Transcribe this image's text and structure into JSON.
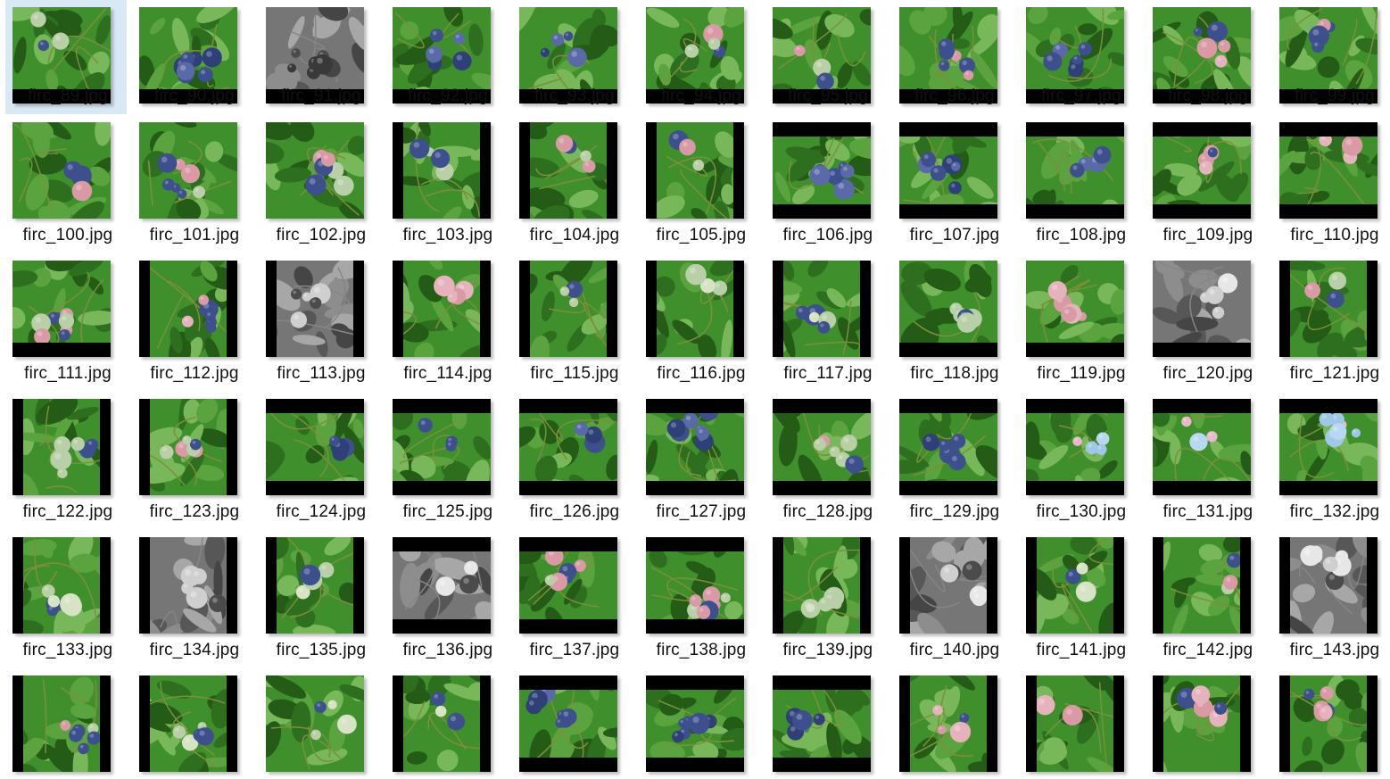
{
  "files": [
    {
      "name": "firc_89.jpg",
      "selected": true,
      "bars": "bottom",
      "gray": false,
      "tilt": 0,
      "berries": "mixed"
    },
    {
      "name": "firc_90.jpg",
      "bars": "bottom",
      "gray": false,
      "tilt": 0,
      "berries": "blue"
    },
    {
      "name": "firc_91.jpg",
      "bars": "bottom",
      "gray": true,
      "tilt": 3,
      "berries": "blue"
    },
    {
      "name": "firc_92.jpg",
      "bars": "bottom",
      "gray": false,
      "tilt": 0,
      "berries": "blue"
    },
    {
      "name": "firc_93.jpg",
      "bars": "bottom",
      "gray": false,
      "tilt": 0,
      "berries": "blue"
    },
    {
      "name": "firc_94.jpg",
      "bars": "bottom",
      "gray": false,
      "tilt": 0,
      "berries": "mixed"
    },
    {
      "name": "firc_95.jpg",
      "bars": "bottom",
      "gray": false,
      "tilt": 2,
      "berries": "mixed"
    },
    {
      "name": "firc_96.jpg",
      "bars": "bottom",
      "gray": false,
      "tilt": 0,
      "berries": "mixed"
    },
    {
      "name": "firc_97.jpg",
      "bars": "bottom",
      "gray": false,
      "tilt": -2,
      "berries": "blue"
    },
    {
      "name": "firc_98.jpg",
      "bars": "bottom",
      "gray": false,
      "tilt": 0,
      "berries": "pink"
    },
    {
      "name": "firc_99.jpg",
      "bars": "bottom",
      "gray": false,
      "tilt": 0,
      "berries": "pink"
    },
    {
      "name": "firc_100.jpg",
      "bars": "none",
      "gray": false,
      "tilt": 0,
      "berries": "mixed"
    },
    {
      "name": "firc_101.jpg",
      "bars": "none",
      "gray": false,
      "tilt": 0,
      "berries": "mixed"
    },
    {
      "name": "firc_102.jpg",
      "bars": "none",
      "gray": false,
      "tilt": -3,
      "berries": "mixed"
    },
    {
      "name": "firc_103.jpg",
      "bars": "sides",
      "gray": false,
      "tilt": 3,
      "berries": "mixed"
    },
    {
      "name": "firc_104.jpg",
      "bars": "sides",
      "gray": false,
      "tilt": -3,
      "berries": "mixed"
    },
    {
      "name": "firc_105.jpg",
      "bars": "sides",
      "gray": false,
      "tilt": 2,
      "berries": "mixed"
    },
    {
      "name": "firc_106.jpg",
      "bars": "topbottom",
      "gray": false,
      "tilt": 0,
      "berries": "blue"
    },
    {
      "name": "firc_107.jpg",
      "bars": "topbottom",
      "gray": false,
      "tilt": 0,
      "berries": "blue"
    },
    {
      "name": "firc_108.jpg",
      "bars": "topbottom",
      "gray": false,
      "tilt": 2,
      "berries": "blue"
    },
    {
      "name": "firc_109.jpg",
      "bars": "topbottom",
      "gray": false,
      "tilt": 0,
      "berries": "pink"
    },
    {
      "name": "firc_110.jpg",
      "bars": "topbottom",
      "gray": false,
      "tilt": -3,
      "berries": "pink"
    },
    {
      "name": "firc_111.jpg",
      "bars": "bottom",
      "gray": false,
      "tilt": 0,
      "berries": "mixed"
    },
    {
      "name": "firc_112.jpg",
      "bars": "sides",
      "gray": false,
      "tilt": 0,
      "berries": "pink"
    },
    {
      "name": "firc_113.jpg",
      "bars": "sides",
      "gray": true,
      "tilt": 0,
      "berries": "green"
    },
    {
      "name": "firc_114.jpg",
      "bars": "sides",
      "gray": false,
      "tilt": -3,
      "berries": "pink"
    },
    {
      "name": "firc_115.jpg",
      "bars": "sides",
      "gray": false,
      "tilt": 0,
      "berries": "green"
    },
    {
      "name": "firc_116.jpg",
      "bars": "sides",
      "gray": false,
      "tilt": 2,
      "berries": "green"
    },
    {
      "name": "firc_117.jpg",
      "bars": "sides",
      "gray": false,
      "tilt": -2,
      "berries": "green"
    },
    {
      "name": "firc_118.jpg",
      "bars": "bottom",
      "gray": false,
      "tilt": 0,
      "berries": "mixed"
    },
    {
      "name": "firc_119.jpg",
      "bars": "bottom",
      "gray": false,
      "tilt": 0,
      "berries": "pink"
    },
    {
      "name": "firc_120.jpg",
      "bars": "bottom",
      "gray": true,
      "tilt": 2,
      "berries": "green"
    },
    {
      "name": "firc_121.jpg",
      "bars": "sides",
      "gray": false,
      "tilt": 3,
      "berries": "mixed"
    },
    {
      "name": "firc_122.jpg",
      "bars": "sides",
      "gray": false,
      "tilt": -4,
      "berries": "mixed"
    },
    {
      "name": "firc_123.jpg",
      "bars": "sides",
      "gray": false,
      "tilt": 4,
      "berries": "mixed"
    },
    {
      "name": "firc_124.jpg",
      "bars": "topbottom",
      "gray": false,
      "tilt": 0,
      "berries": "blue"
    },
    {
      "name": "firc_125.jpg",
      "bars": "topbottom",
      "gray": false,
      "tilt": 0,
      "berries": "blue"
    },
    {
      "name": "firc_126.jpg",
      "bars": "topbottom",
      "gray": false,
      "tilt": -2,
      "berries": "blue"
    },
    {
      "name": "firc_127.jpg",
      "bars": "topbottom",
      "gray": false,
      "tilt": 0,
      "berries": "blue"
    },
    {
      "name": "firc_128.jpg",
      "bars": "topbottom",
      "gray": false,
      "tilt": 0,
      "berries": "mixed"
    },
    {
      "name": "firc_129.jpg",
      "bars": "topbottom",
      "gray": false,
      "tilt": 2,
      "berries": "blue"
    },
    {
      "name": "firc_130.jpg",
      "bars": "topbottom",
      "gray": false,
      "tilt": 0,
      "berries": "light"
    },
    {
      "name": "firc_131.jpg",
      "bars": "topbottom",
      "gray": false,
      "tilt": 0,
      "berries": "light"
    },
    {
      "name": "firc_132.jpg",
      "bars": "topbottom",
      "gray": false,
      "tilt": -3,
      "berries": "light"
    },
    {
      "name": "firc_133.jpg",
      "bars": "sides",
      "gray": false,
      "tilt": 0,
      "berries": "green"
    },
    {
      "name": "firc_134.jpg",
      "bars": "sides",
      "gray": true,
      "tilt": -2,
      "berries": "green"
    },
    {
      "name": "firc_135.jpg",
      "bars": "sides",
      "gray": false,
      "tilt": 0,
      "berries": "green"
    },
    {
      "name": "firc_136.jpg",
      "bars": "topbottom",
      "gray": true,
      "tilt": 0,
      "berries": "green"
    },
    {
      "name": "firc_137.jpg",
      "bars": "topbottom",
      "gray": false,
      "tilt": 0,
      "berries": "mixed"
    },
    {
      "name": "firc_138.jpg",
      "bars": "topbottom",
      "gray": false,
      "tilt": -3,
      "berries": "mixed"
    },
    {
      "name": "firc_139.jpg",
      "bars": "sides",
      "gray": false,
      "tilt": 0,
      "berries": "green"
    },
    {
      "name": "firc_140.jpg",
      "bars": "sides",
      "gray": true,
      "tilt": 0,
      "berries": "green"
    },
    {
      "name": "firc_141.jpg",
      "bars": "sides",
      "gray": false,
      "tilt": -3,
      "berries": "green"
    },
    {
      "name": "firc_142.jpg",
      "bars": "sides",
      "gray": false,
      "tilt": 3,
      "berries": "mixed"
    },
    {
      "name": "firc_143.jpg",
      "bars": "sides",
      "gray": true,
      "tilt": 0,
      "berries": "green"
    },
    {
      "name": "",
      "bars": "sides",
      "gray": false,
      "tilt": 0,
      "berries": "mixed"
    },
    {
      "name": "",
      "bars": "sides",
      "gray": false,
      "tilt": 0,
      "berries": "green"
    },
    {
      "name": "",
      "bars": "none",
      "gray": false,
      "tilt": 0,
      "berries": "green"
    },
    {
      "name": "",
      "bars": "sides",
      "gray": false,
      "tilt": -2,
      "berries": "green"
    },
    {
      "name": "",
      "bars": "topbottom",
      "gray": false,
      "tilt": 0,
      "berries": "blue"
    },
    {
      "name": "",
      "bars": "topbottom",
      "gray": false,
      "tilt": 0,
      "berries": "blue"
    },
    {
      "name": "",
      "bars": "topbottom",
      "gray": false,
      "tilt": 0,
      "berries": "blue"
    },
    {
      "name": "",
      "bars": "sides",
      "gray": false,
      "tilt": 3,
      "berries": "pink"
    },
    {
      "name": "",
      "bars": "sides",
      "gray": false,
      "tilt": -3,
      "berries": "pink"
    },
    {
      "name": "",
      "bars": "sides",
      "gray": false,
      "tilt": 2,
      "berries": "pink"
    },
    {
      "name": "",
      "bars": "sides",
      "gray": false,
      "tilt": -3,
      "berries": "pink"
    }
  ],
  "colors": {
    "selection": "#d9e8f5",
    "leaf": "#3f8f2c",
    "leaf_dark": "#235b17",
    "leaf_light": "#79b85a",
    "berry_blue": "#3d4f8c",
    "berry_pink": "#d99aa6",
    "berry_green": "#b9cfa8",
    "berry_light": "#9fc8e6",
    "bar": "#000000"
  }
}
